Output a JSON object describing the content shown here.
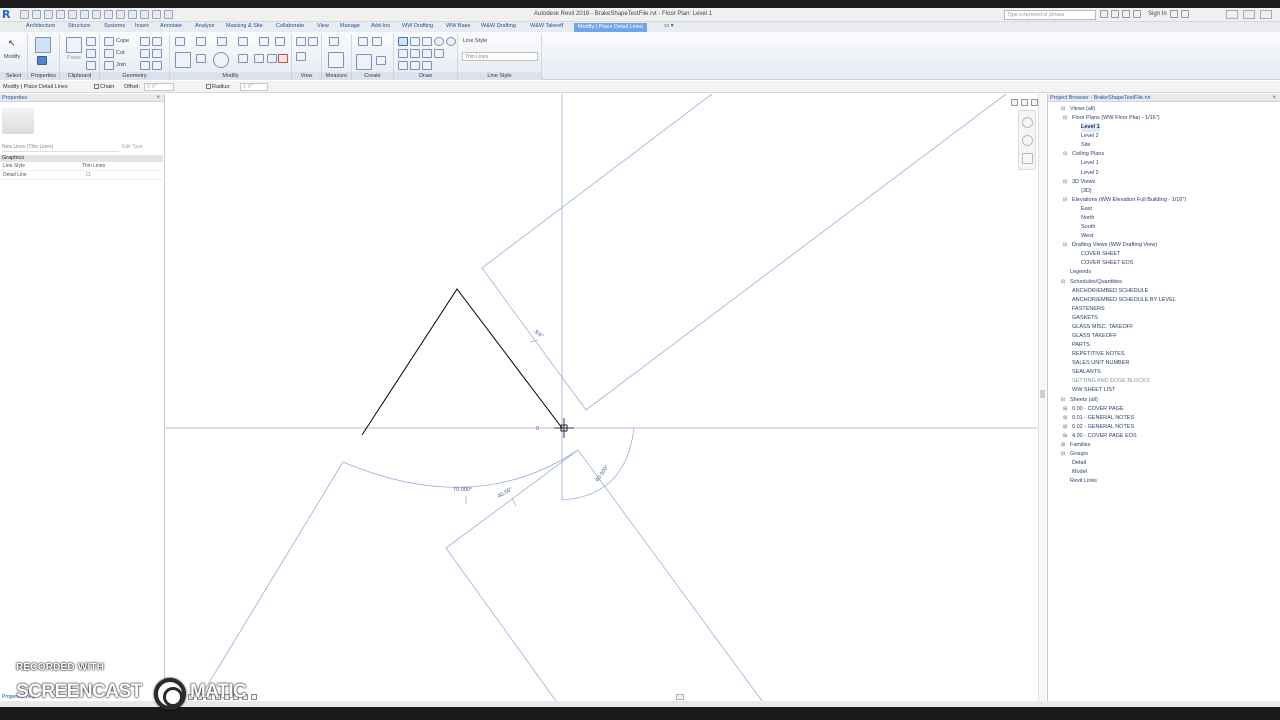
{
  "window": {
    "title": "Autodesk Revit 2016 -  BrakeShapeTestFile.rvt - Floor Plan: Level 1",
    "search_placeholder": "Type a keyword or phrase",
    "sign_in": "Sign In"
  },
  "tabs": [
    "Architecture",
    "Structure",
    "Systems",
    "Insert",
    "Annotate",
    "Analyze",
    "Massing & Site",
    "Collaborate",
    "View",
    "Manage",
    "Add-Ins",
    "WW Drafting",
    "WW Base",
    "W&W Drafting",
    "W&W Takeoff",
    "Modify | Place Detail Lines"
  ],
  "ribbon": {
    "select_label": "Select",
    "modify_label": "Modify",
    "paste_label": "Paste",
    "cope_label": "Cope",
    "cut_label": "Cut",
    "join_label": "Join",
    "line_style_label": "Line Style",
    "line_style_value": "Thin Lines",
    "panels": [
      "Select",
      "Properties",
      "Clipboard",
      "Geometry",
      "Modify",
      "View",
      "Measure",
      "Create",
      "Draw",
      "Line Style"
    ]
  },
  "options_bar": {
    "context": "Modify | Place Detail Lines",
    "chain_label": "Chain",
    "offset_label": "Offset:",
    "offset_value": "0' 0\"",
    "radius_label": "Radius:",
    "radius_value": "1' 0\""
  },
  "properties": {
    "title": "Properties",
    "type_selector": "New Lines (Thin Lines)",
    "edit_type": "Edit Type",
    "group": "Graphics",
    "rows": [
      {
        "key": "Line Style",
        "value": "Thin Lines"
      },
      {
        "key": "Detail Line",
        "value": ""
      }
    ],
    "apply_link": "Properties help"
  },
  "drawing": {
    "dimensions": {
      "d1": "70.000°",
      "d2": "40.00°",
      "d3": "90.000°",
      "d4": "3/4\"",
      "d5": "0"
    }
  },
  "project_browser": {
    "title": "Project Browser - BrakeShapeTestFile.rvt",
    "rows": [
      {
        "label": "Views (all)",
        "depth": 0,
        "toggle": "⊟"
      },
      {
        "label": "Floor Plans (WW Floor Plan - 1/16\")",
        "depth": 1,
        "toggle": "⊟"
      },
      {
        "label": "Level 1",
        "depth": 2,
        "toggle": "",
        "style": "bold selected"
      },
      {
        "label": "Level 2",
        "depth": 2,
        "toggle": ""
      },
      {
        "label": "Site",
        "depth": 2,
        "toggle": ""
      },
      {
        "label": "Ceiling Plans",
        "depth": 1,
        "toggle": "⊟"
      },
      {
        "label": "Level 1",
        "depth": 2,
        "toggle": ""
      },
      {
        "label": "Level 2",
        "depth": 2,
        "toggle": ""
      },
      {
        "label": "3D Views",
        "depth": 1,
        "toggle": "⊟"
      },
      {
        "label": "{3D}",
        "depth": 2,
        "toggle": ""
      },
      {
        "label": "Elevations (WW Elevation Full Building - 1/16\")",
        "depth": 1,
        "toggle": "⊟"
      },
      {
        "label": "East",
        "depth": 2,
        "toggle": ""
      },
      {
        "label": "North",
        "depth": 2,
        "toggle": ""
      },
      {
        "label": "South",
        "depth": 2,
        "toggle": ""
      },
      {
        "label": "West",
        "depth": 2,
        "toggle": ""
      },
      {
        "label": "Drafting Views (WW Drafting View)",
        "depth": 1,
        "toggle": "⊟"
      },
      {
        "label": "COVER SHEET",
        "depth": 2,
        "toggle": ""
      },
      {
        "label": "COVER SHEET EOS",
        "depth": 2,
        "toggle": ""
      },
      {
        "label": "Legends",
        "depth": 0,
        "toggle": ""
      },
      {
        "label": "Schedules/Quantities",
        "depth": 0,
        "toggle": "⊟"
      },
      {
        "label": "ANCHOR/EMBED SCHEDULE",
        "depth": 1,
        "toggle": ""
      },
      {
        "label": "ANCHOR/EMBED SCHEDULE BY LEVEL",
        "depth": 1,
        "toggle": ""
      },
      {
        "label": "FASTENERS",
        "depth": 1,
        "toggle": ""
      },
      {
        "label": "GASKETS",
        "depth": 1,
        "toggle": ""
      },
      {
        "label": "GLASS MISC. TAKEOFF",
        "depth": 1,
        "toggle": ""
      },
      {
        "label": "GLASS TAKEOFF",
        "depth": 1,
        "toggle": ""
      },
      {
        "label": "PARTS",
        "depth": 1,
        "toggle": ""
      },
      {
        "label": "REPETITIVE NOTES",
        "depth": 1,
        "toggle": ""
      },
      {
        "label": "SALES UNIT NUMBER",
        "depth": 1,
        "toggle": ""
      },
      {
        "label": "SEALANTS",
        "depth": 1,
        "toggle": ""
      },
      {
        "label": "SETTING AND EDGE BLOCKS",
        "depth": 1,
        "toggle": "",
        "style": "faded"
      },
      {
        "label": "WW SHEET LIST",
        "depth": 1,
        "toggle": ""
      },
      {
        "label": "Sheets (all)",
        "depth": 0,
        "toggle": "⊟"
      },
      {
        "label": "0.00 - COVER PAGE",
        "depth": 1,
        "toggle": "⊞"
      },
      {
        "label": "0.01 - GENERAL NOTES",
        "depth": 1,
        "toggle": "⊞"
      },
      {
        "label": "0.02 - GENERAL NOTES",
        "depth": 1,
        "toggle": "⊞"
      },
      {
        "label": "4.00 - COVER PAGE EOS",
        "depth": 1,
        "toggle": "⊞"
      },
      {
        "label": "Families",
        "depth": 0,
        "toggle": "⊞"
      },
      {
        "label": "Groups",
        "depth": 0,
        "toggle": "⊟"
      },
      {
        "label": "Detail",
        "depth": 1,
        "toggle": ""
      },
      {
        "label": "Model",
        "depth": 1,
        "toggle": ""
      },
      {
        "label": "Revit Links",
        "depth": 0,
        "toggle": ""
      }
    ]
  },
  "watermark": {
    "top": "RECORDED WITH",
    "left": "SCREENCAST",
    "right": "MATIC"
  },
  "colors": {
    "accent": "#6fa6e8",
    "tab_text": "#1a4f9c",
    "sketch_line": "#8fa6d4",
    "model_line": "#000000"
  }
}
